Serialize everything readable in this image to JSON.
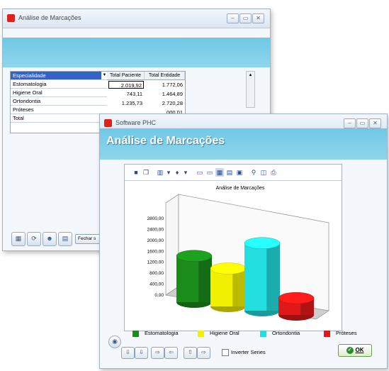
{
  "back_window": {
    "title": "Análise de Marcações",
    "controls": [
      "–",
      "▭",
      "✕"
    ],
    "list_items": [
      "Especialidade",
      "Estomatologia",
      "Higiene Oral",
      "Ortondontia",
      "Próteses",
      "Total"
    ],
    "grid_headers": [
      "Total Paciente",
      "Total Entidade"
    ],
    "grid_rows": [
      [
        "2.019,92",
        "1.772,06"
      ],
      [
        "743,11",
        "1.464,89"
      ],
      [
        "1.235,73",
        "2.720,28"
      ],
      [
        "",
        "000,01"
      ]
    ],
    "bottom_button_label": "Fechar s"
  },
  "front_window": {
    "title": "Software PHC",
    "controls": [
      "–",
      "▭",
      "✕"
    ],
    "banner_title": "Análise de Marcações",
    "toolbar_icons": [
      "save-icon",
      "copy-icon",
      "chart-type-icon",
      "color-icon",
      "page-icon",
      "page2-icon",
      "grid-view-icon",
      "table-view-icon",
      "image-icon",
      "zoom-icon",
      "print-preview-icon",
      "print-icon"
    ],
    "inverter_label": "Inverter Series",
    "ok_label": "OK",
    "nav_buttons": [
      "⇩",
      "⇩",
      "⇨",
      "⇦",
      "⇧",
      "⇨"
    ]
  },
  "chart_data": {
    "type": "bar",
    "title": "Análise de Marcações",
    "categories": [
      "Estomatologia",
      "Higiene Oral",
      "Ortondontia",
      "Próteses"
    ],
    "series": [
      {
        "name": "Estomatologia",
        "values": [
          1780
        ],
        "color": "#1a8c1a"
      },
      {
        "name": "Higiene Oral",
        "values": [
          1460
        ],
        "color": "#f0f000"
      },
      {
        "name": "Ortondontia",
        "values": [
          2600
        ],
        "color": "#22dede"
      },
      {
        "name": "Próteses",
        "values": [
          650
        ],
        "color": "#e01818"
      }
    ],
    "values": [
      1780,
      1460,
      2600,
      650
    ],
    "colors": [
      "#1a8c1a",
      "#f0f000",
      "#22dede",
      "#e01818"
    ],
    "y_ticks": [
      "2800,00",
      "2400,00",
      "2000,00",
      "1600,00",
      "1200,00",
      "800,00",
      "400,00",
      "0,00"
    ],
    "ylim": [
      0,
      2800
    ],
    "style": "3d-cylinder",
    "legend_position": "bottom"
  }
}
